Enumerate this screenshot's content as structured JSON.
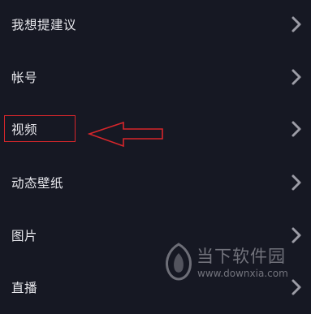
{
  "settings": {
    "items": [
      {
        "label": "我想提建议"
      },
      {
        "label": "帐号"
      },
      {
        "label": "视频"
      },
      {
        "label": "动态壁纸"
      },
      {
        "label": "图片"
      },
      {
        "label": "直播"
      }
    ]
  },
  "annotation": {
    "highlight_color": "#d7262b",
    "arrow_icon": "left-arrow-icon"
  },
  "watermark": {
    "title": "当下软件园",
    "url": "www.downxia.com"
  },
  "colors": {
    "background": "#161823",
    "text": "#e7e7ec",
    "chevron": "#9c9ca6"
  }
}
